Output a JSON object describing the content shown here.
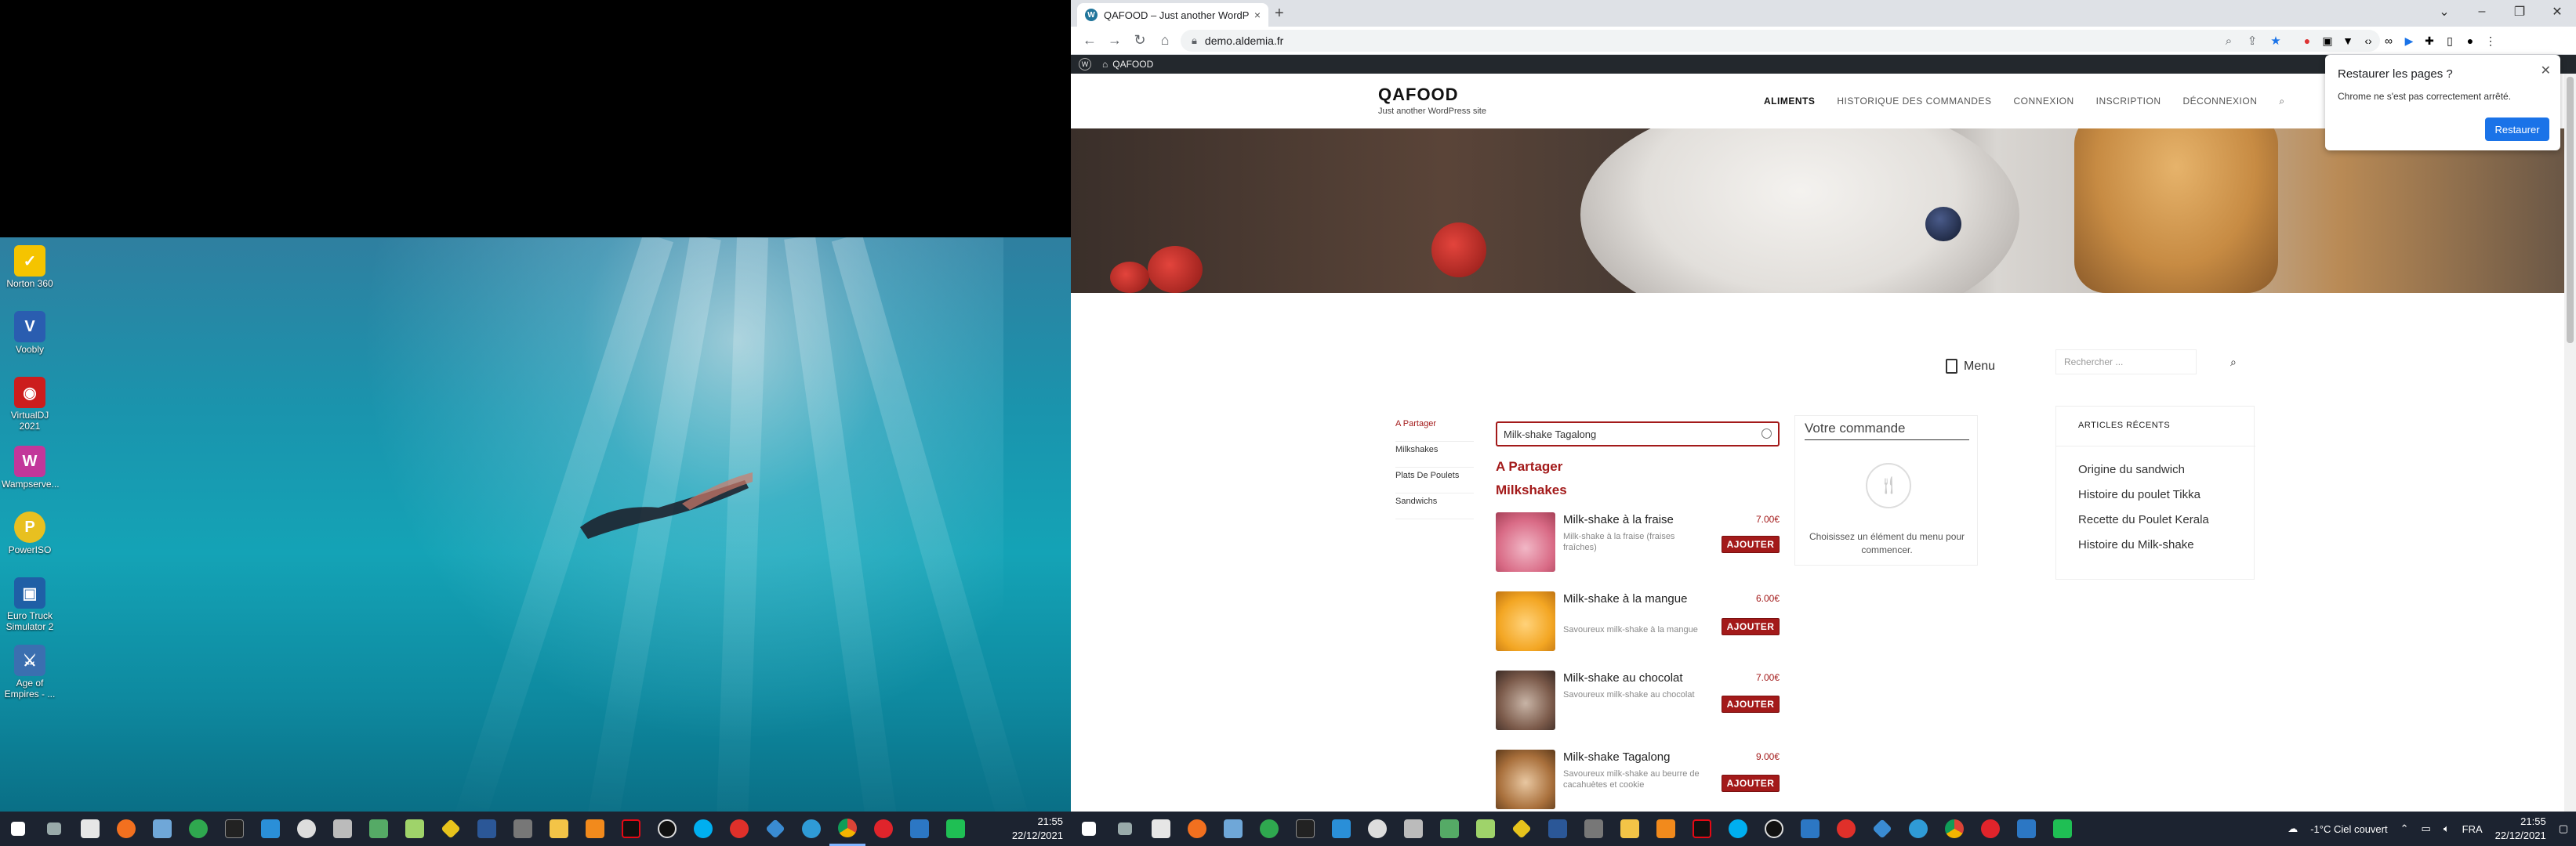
{
  "left_screen": {
    "desktop_icons": [
      {
        "label": "Norton 360",
        "icon": "norton-icon",
        "color": "#f5c400"
      },
      {
        "label": "Voobly",
        "icon": "voobly-icon",
        "color": "#2a5db0"
      },
      {
        "label": "VirtualDJ 2021",
        "icon": "virtualdj-icon",
        "color": "#cc1d1d"
      },
      {
        "label": "Wampserve...",
        "icon": "wampserver-icon",
        "color": "#c2379a"
      },
      {
        "label": "PowerISO",
        "icon": "poweriso-icon",
        "color": "#e8c020"
      },
      {
        "label": "Euro Truck Simulator 2",
        "icon": "eurotruck-icon",
        "color": "#1f5fa6"
      },
      {
        "label": "Age of Empires - ...",
        "icon": "aoe-icon",
        "color": "#3b6fb0"
      }
    ],
    "taskbar": {
      "time": "21:55",
      "date": "22/12/2021"
    }
  },
  "browser": {
    "tab_title": "QAFOOD – Just another WordPr...",
    "url": "demo.aldemia.fr",
    "admin_bar_site": "QAFOOD",
    "restore_popup": {
      "title": "Restaurer les pages ?",
      "message": "Chrome ne s'est pas correctement arrêté.",
      "button": "Restaurer"
    }
  },
  "site": {
    "name": "QAFOOD",
    "tagline": "Just another WordPress site",
    "nav": [
      "ALIMENTS",
      "HISTORIQUE DES COMMANDES",
      "CONNEXION",
      "INSCRIPTION",
      "DÉCONNEXION"
    ],
    "menu_label": "Menu",
    "categories": [
      "A Partager",
      "Milkshakes",
      "Plats De Poulets",
      "Sandwichs"
    ],
    "search_value": "Milk-shake Tagalong",
    "section_share": "A Partager",
    "section_milkshakes": "Milkshakes",
    "add_label": "AJOUTER",
    "products": [
      {
        "name": "Milk-shake à la fraise",
        "desc": "Milk-shake à la fraise (fraises fraîches)",
        "price": "7.00€"
      },
      {
        "name": "Milk-shake à la mangue",
        "desc": "Savoureux milk-shake à la mangue",
        "price": "6.00€"
      },
      {
        "name": "Milk-shake au chocolat",
        "desc": "Savoureux milk-shake au chocolat",
        "price": "7.00€"
      },
      {
        "name": "Milk-shake Tagalong",
        "desc": "Savoureux milk-shake au beurre de cacahuètes et cookie",
        "price": "9.00€"
      }
    ],
    "order": {
      "title": "Votre commande",
      "empty_text": "Choisissez un élément du menu pour commencer."
    },
    "sidebar": {
      "search_placeholder": "Rechercher ...",
      "recent_title": "ARTICLES RÉCENTS",
      "recent_items": [
        "Origine du sandwich",
        "Histoire du poulet Tikka",
        "Recette du Poulet Kerala",
        "Histoire du Milk-shake"
      ]
    }
  },
  "right_taskbar": {
    "weather": "-1°C  Ciel couvert",
    "lang": "FRA",
    "time": "21:55",
    "date": "22/12/2021"
  }
}
